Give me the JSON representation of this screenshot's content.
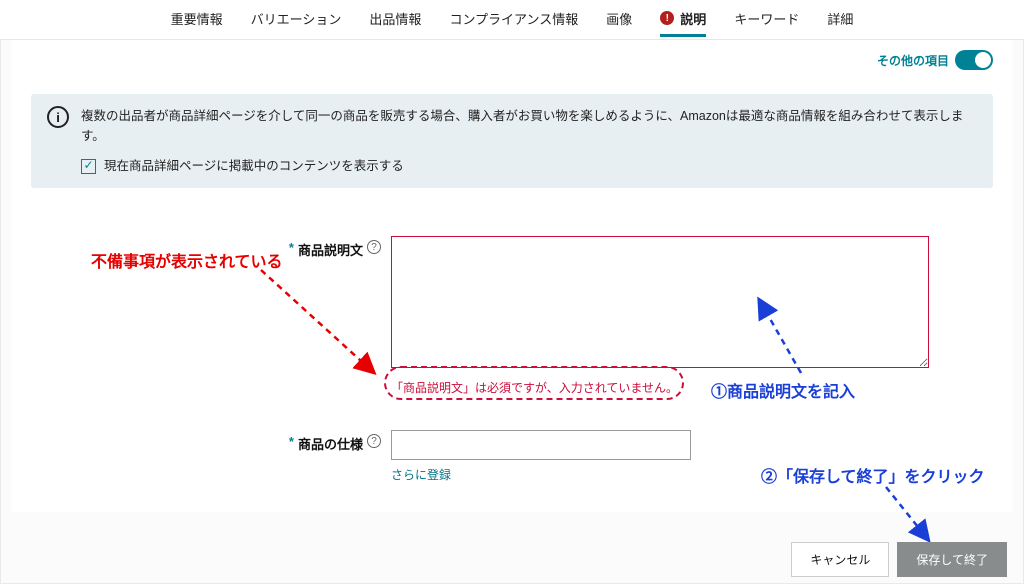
{
  "tabs": {
    "important": "重要情報",
    "variation": "バリエーション",
    "listing": "出品情報",
    "compliance": "コンプライアンス情報",
    "image": "画像",
    "description": "説明",
    "keywords": "キーワード",
    "detail": "詳細"
  },
  "other_items_label": "その他の項目",
  "info_text": "複数の出品者が商品詳細ページを介して同一の商品を販売する場合、購入者がお買い物を楽しめるように、Amazonは最適な商品情報を組み合わせて表示します。",
  "checkbox_label": "現在商品詳細ページに掲載中のコンテンツを表示する",
  "form": {
    "description_label": "商品説明文",
    "description_value": "",
    "description_error": "「商品説明文」は必須ですが、入力されていません。",
    "spec_label": "商品の仕様",
    "spec_value": "",
    "more_link": "さらに登録"
  },
  "buttons": {
    "cancel": "キャンセル",
    "save": "保存して終了"
  },
  "annotations": {
    "red_label": "不備事項が表示されている",
    "blue_step1": "①商品説明文を記入",
    "blue_step2": "②「保存して終了」をクリック"
  }
}
